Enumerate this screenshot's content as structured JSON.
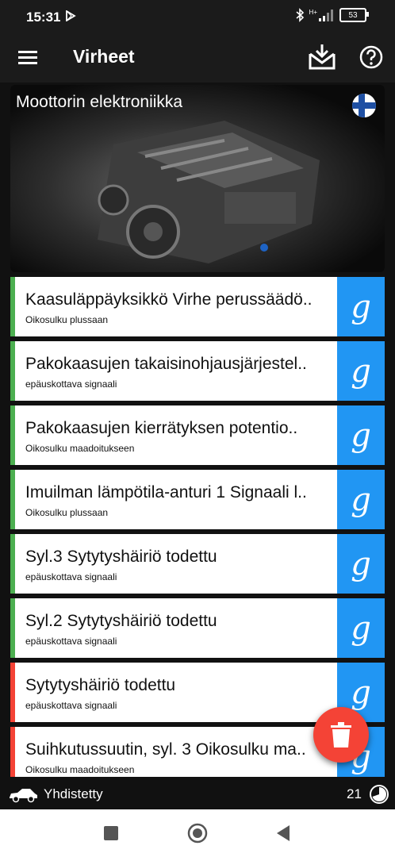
{
  "status_bar": {
    "time": "15:31",
    "battery": "53",
    "network": "H+"
  },
  "app_bar": {
    "title": "Virheet"
  },
  "banner": {
    "title": "Moottorin elektroniikka"
  },
  "faults": [
    {
      "title": "Kaasuläppäyksikkö Virhe perussäädö..",
      "subtitle": "Oikosulku plussaan",
      "status": "green"
    },
    {
      "title": "Pakokaasujen takaisinohjausjärjestel..",
      "subtitle": "epäuskottava signaali",
      "status": "green"
    },
    {
      "title": "Pakokaasujen kierrätyksen potentio..",
      "subtitle": "Oikosulku maadoitukseen",
      "status": "green"
    },
    {
      "title": "Imuilman lämpötila-anturi 1 Signaali l..",
      "subtitle": "Oikosulku plussaan",
      "status": "green"
    },
    {
      "title": "Syl.3 Sytytyshäiriö todettu",
      "subtitle": "epäuskottava signaali",
      "status": "green"
    },
    {
      "title": "Syl.2 Sytytyshäiriö todettu",
      "subtitle": "epäuskottava signaali",
      "status": "green"
    },
    {
      "title": "Sytytyshäiriö todettu",
      "subtitle": "epäuskottava signaali",
      "status": "red"
    },
    {
      "title": "Suihkutussuutin, syl. 3 Oikosulku ma..",
      "subtitle": "Oikosulku maadoitukseen",
      "status": "red"
    }
  ],
  "search_glyph": "g",
  "bottom_status": {
    "connection": "Yhdistetty",
    "count": "21"
  },
  "colors": {
    "green": "#4caf50",
    "red": "#f44336",
    "accent": "#2196f3"
  }
}
